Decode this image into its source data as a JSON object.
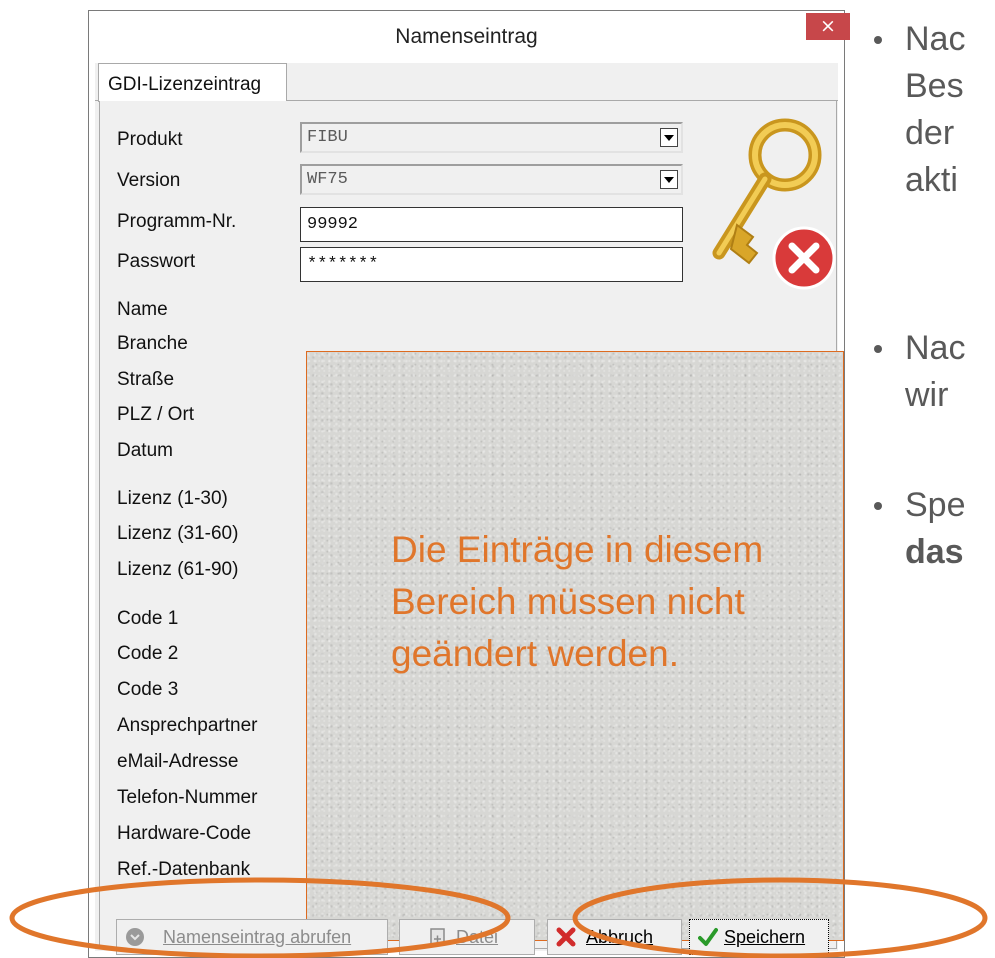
{
  "dialog": {
    "title": "Namenseintrag",
    "close_glyph": "×",
    "tab": "GDI-Lizenzeintrag",
    "fields": {
      "produkt_label": "Produkt",
      "produkt_value": "FIBU",
      "version_label": "Version",
      "version_value": "WF75",
      "programm_label": "Programm-Nr.",
      "programm_value": "99992",
      "passwort_label": "Passwort",
      "passwort_value": "*******"
    },
    "labels": [
      "Name",
      "Branche",
      "Straße",
      "PLZ / Ort",
      "Datum",
      "Lizenz (1-30)",
      "Lizenz (31-60)",
      "Lizenz (61-90)",
      "Code 1",
      "Code 2",
      "Code 3",
      "Ansprechpartner",
      "eMail-Adresse",
      "Telefon-Nummer",
      "Hardware-Code",
      "Ref.-Datenbank"
    ],
    "note": "Die Einträge in diesem Bereich müssen nicht geändert werden.",
    "buttons": {
      "namenseintrag": "Namenseintrag abrufen",
      "datei": "Datei",
      "abbruch": "Abbruch",
      "speichern": "Speichern"
    }
  },
  "slide_bullets": [
    "Nac",
    "Bes",
    "der",
    "akti",
    "Nac",
    "wir",
    "Spe",
    "das"
  ],
  "icons": [
    "key-icon",
    "error-x-icon",
    "download-icon",
    "file-icon",
    "cancel-icon",
    "checkmark-icon",
    "dropdown-arrow-icon"
  ],
  "colors": {
    "accent_orange": "#e0762b",
    "close_red": "#c7474a",
    "panel_bg": "#f0f0f0"
  }
}
